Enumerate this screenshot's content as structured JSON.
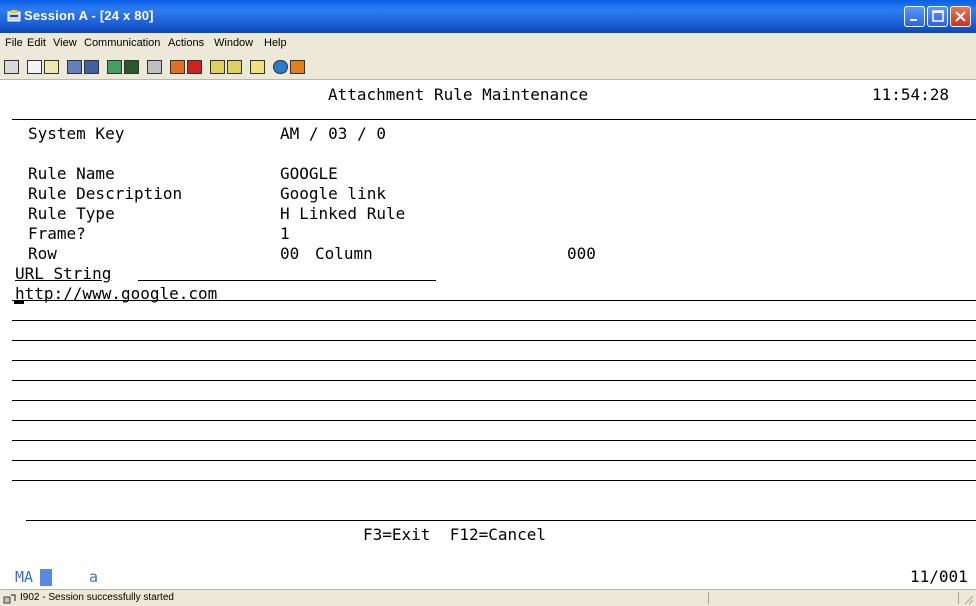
{
  "window": {
    "title": "Session A - [24 x 80]"
  },
  "menu": [
    "File",
    "Edit",
    "View",
    "Communication",
    "Actions",
    "Window",
    "Help"
  ],
  "toolbar_icons": [
    "print-screen-icon",
    "copy-icon",
    "paste-icon",
    "send-icon",
    "receive-icon",
    "display-icon",
    "keypad-icon",
    "macro-icon",
    "record-icon",
    "stop-icon",
    "play-icon",
    "quick-play-icon",
    "clipboard-icon",
    "globe-icon",
    "pencil-icon"
  ],
  "screen": {
    "heading": "Attachment Rule Maintenance",
    "time": "11:54:28",
    "fields": {
      "system_key_label": "System Key",
      "system_key_value": "AM / 03 / 0",
      "rule_name_label": "Rule Name",
      "rule_name_value": "GOOGLE",
      "rule_description_label": "Rule Description",
      "rule_description_value": "Google link",
      "rule_type_label": "Rule Type",
      "rule_type_value": "H Linked Rule",
      "frame_label": "Frame?",
      "frame_value": "1",
      "row_label": "Row",
      "row_value": "00",
      "column_label": "Column",
      "column_value": "000",
      "url_label": "URL String",
      "url_value": "http://www.google.com"
    },
    "function_keys": "F3=Exit  F12=Cancel",
    "oia_left": "MA",
    "oia_mode": "a",
    "oia_cursor": "11/001"
  },
  "status": {
    "text": "I902 - Session successfully started"
  },
  "colors": {
    "title_bar": "#1d61d9",
    "oia_text": "#3b6fd8",
    "oia_block": "#5a88e6"
  }
}
